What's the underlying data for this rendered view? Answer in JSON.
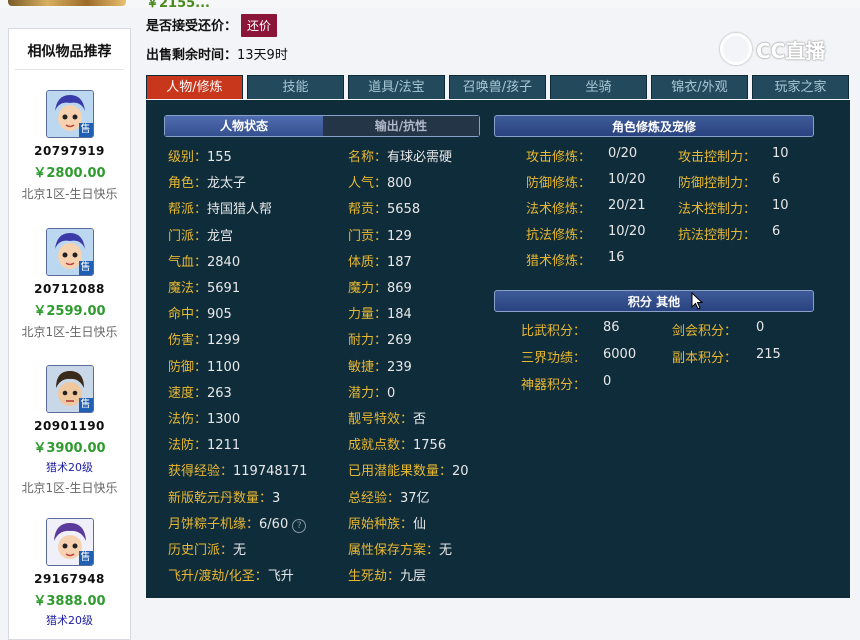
{
  "header": {
    "price_partial": "￥2155...",
    "bargain_label": "是否接受还价：",
    "bargain_button": "还价",
    "remain_label": "出售剩余时间：",
    "remain_value": "13天9时",
    "logo_text": "CC直播"
  },
  "sidebar": {
    "title": "相似物品推荐",
    "items": [
      {
        "id": "20797919",
        "price": "￥2800.00",
        "extra": "",
        "server": "北京1区-生日快乐"
      },
      {
        "id": "20712088",
        "price": "￥2599.00",
        "extra": "",
        "server": "北京1区-生日快乐"
      },
      {
        "id": "20901190",
        "price": "￥3900.00",
        "extra": "猎术20级",
        "server": "北京1区-生日快乐"
      },
      {
        "id": "29167948",
        "price": "￥3888.00",
        "extra": "猎术20级",
        "server": ""
      }
    ],
    "badge": "售"
  },
  "tabs": [
    "人物/修炼",
    "技能",
    "道具/法宝",
    "召唤兽/孩子",
    "坐骑",
    "锦衣/外观",
    "玩家之家"
  ],
  "panel": {
    "state_tab": "人物状态",
    "output_tab": "输出/抗性",
    "cult_title": "角色修炼及宠修",
    "score_title": "积分 其他",
    "left": [
      {
        "k": "级别：",
        "v": "155"
      },
      {
        "k": "角色：",
        "v": "龙太子"
      },
      {
        "k": "帮派：",
        "v": "持国猎人帮"
      },
      {
        "k": "门派：",
        "v": "龙宫"
      },
      {
        "k": "气血：",
        "v": "2840"
      },
      {
        "k": "魔法：",
        "v": "5691"
      },
      {
        "k": "命中：",
        "v": "905"
      },
      {
        "k": "伤害：",
        "v": "1299"
      },
      {
        "k": "防御：",
        "v": "1100"
      },
      {
        "k": "速度：",
        "v": "263"
      },
      {
        "k": "法伤：",
        "v": "1300"
      },
      {
        "k": "法防：",
        "v": "1211"
      },
      {
        "k": "获得经验：",
        "v": "119748171"
      },
      {
        "k": "新版乾元丹数量：",
        "v": "3"
      },
      {
        "k": "月饼粽子机缘：",
        "v": "6/60"
      },
      {
        "k": "历史门派：",
        "v": "无"
      },
      {
        "k": "飞升/渡劫/化圣：",
        "v": "飞升"
      }
    ],
    "mid": [
      {
        "k": "名称：",
        "v": "有球必需硬"
      },
      {
        "k": "人气：",
        "v": "800"
      },
      {
        "k": "帮贡：",
        "v": "5658"
      },
      {
        "k": "门贡：",
        "v": "129"
      },
      {
        "k": "体质：",
        "v": "187"
      },
      {
        "k": "魔力：",
        "v": "869"
      },
      {
        "k": "力量：",
        "v": "184"
      },
      {
        "k": "耐力：",
        "v": "269"
      },
      {
        "k": "敏捷：",
        "v": "239"
      },
      {
        "k": "潜力：",
        "v": "0"
      },
      {
        "k": "靓号特效：",
        "v": "否"
      },
      {
        "k": "成就点数：",
        "v": "1756"
      },
      {
        "k": "已用潜能果数量：",
        "v": "20"
      },
      {
        "k": "总经验：",
        "v": "37亿"
      },
      {
        "k": "原始种族：",
        "v": "仙"
      },
      {
        "k": "属性保存方案：",
        "v": "无"
      },
      {
        "k": "生死劫：",
        "v": "九层"
      }
    ],
    "cult_left": [
      {
        "k": "攻击修炼：",
        "v": "0/20"
      },
      {
        "k": "防御修炼：",
        "v": "10/20"
      },
      {
        "k": "法术修炼：",
        "v": "20/21"
      },
      {
        "k": "抗法修炼：",
        "v": "10/20"
      },
      {
        "k": "猎术修炼：",
        "v": "16"
      }
    ],
    "cult_right": [
      {
        "k": "攻击控制力：",
        "v": "10"
      },
      {
        "k": "防御控制力：",
        "v": "6"
      },
      {
        "k": "法术控制力：",
        "v": "10"
      },
      {
        "k": "抗法控制力：",
        "v": "6"
      }
    ],
    "score_left": [
      {
        "k": "比武积分：",
        "v": "86"
      },
      {
        "k": "三界功绩：",
        "v": "6000"
      },
      {
        "k": "神器积分：",
        "v": "0"
      }
    ],
    "score_right": [
      {
        "k": "剑会积分：",
        "v": "0"
      },
      {
        "k": "副本积分：",
        "v": "215"
      }
    ],
    "help_icon": "?"
  }
}
